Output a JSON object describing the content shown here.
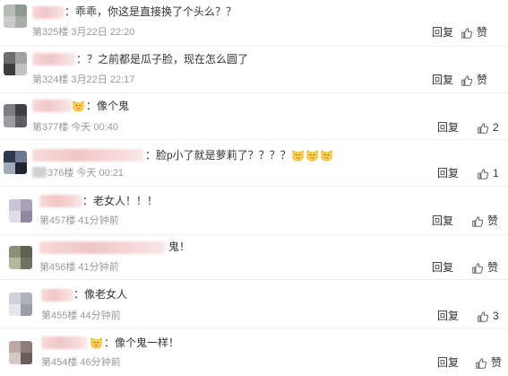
{
  "comments": [
    {
      "text": "：乖乖，你这是直接换了个头么？？",
      "floor": "第325楼",
      "time": "3月22日 22:20",
      "reply_label": "回复",
      "like_label": "赞",
      "avatar_colors": [
        "#b8bcb7",
        "#8f9a8e",
        "#c9ccc8",
        "#a7b0a6"
      ]
    },
    {
      "text": "：？之前都是瓜子脸，现在怎么圆了",
      "floor": "第324楼",
      "time": "3月22日 22:17",
      "reply_label": "回复",
      "like_label": "赞",
      "avatar_colors": [
        "#6d6d6d",
        "#a1a1a1",
        "#3e3e3e",
        "#c2c2c2"
      ]
    },
    {
      "text": "：像个鬼",
      "floor": "第377楼",
      "time": "今天 00:40",
      "reply_label": "回复",
      "like_count": "2",
      "avatar_colors": [
        "#7d7e82",
        "#3f3f45",
        "#9c9da2",
        "#5d5e63"
      ]
    },
    {
      "text": "：脸p小了就是萝莉了？？？？",
      "floor": "376楼",
      "time": "今天 00:21",
      "reply_label": "回复",
      "like_count": "1",
      "avatar_colors": [
        "#2d3a4e",
        "#6c7a90",
        "#a0aab8",
        "#1e2430"
      ]
    },
    {
      "text": "：老女人！！！",
      "floor": "第457楼",
      "time": "41分钟前",
      "reply_label": "回复",
      "like_label": "赞",
      "avatar_colors": [
        "#c9c5d6",
        "#a7a2b8",
        "#e0dde9",
        "#8f8aa2"
      ]
    },
    {
      "text": "鬼！",
      "floor": "第456楼",
      "time": "41分钟前",
      "reply_label": "回复",
      "like_label": "赞",
      "avatar_colors": [
        "#8a8f78",
        "#5e6350",
        "#b3b79e",
        "#6f7461"
      ]
    },
    {
      "text": "：像老女人",
      "floor": "第455楼",
      "time": "44分钟前",
      "reply_label": "回复",
      "like_count": "3",
      "avatar_colors": [
        "#cfd2d8",
        "#aeb2ba",
        "#e4e6ea",
        "#9a9ea6"
      ]
    },
    {
      "text": "：像个鬼一样！",
      "floor": "第454楼",
      "time": "46分钟前",
      "reply_label": "回复",
      "like_label": "赞",
      "avatar_colors": [
        "#b9a8a5",
        "#8f7b78",
        "#d5c8c6",
        "#6e5d5a"
      ]
    }
  ],
  "icons": {
    "thumbs_up": "thumbs-up-icon",
    "emoji": "smiling-cat-emoji"
  },
  "colors": {
    "text": "#333333",
    "meta": "#999999",
    "divider": "#eeeeee",
    "name_blur": "#f0c6c6"
  }
}
